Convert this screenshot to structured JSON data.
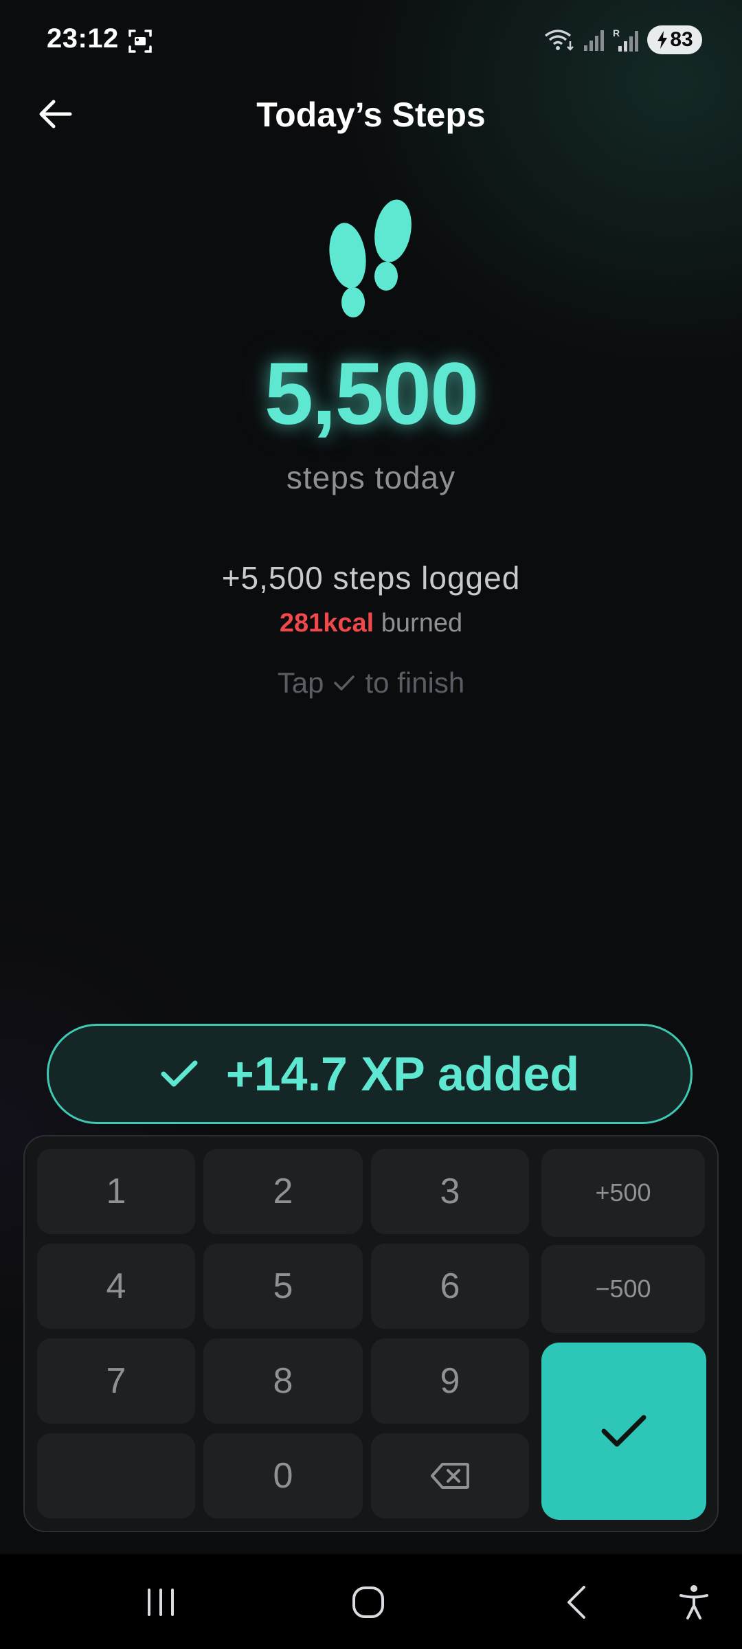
{
  "status_bar": {
    "time": "23:12",
    "battery_level": "83"
  },
  "header": {
    "title": "Today’s Steps"
  },
  "steps": {
    "value": "5,500",
    "caption": "steps today",
    "logged_text": "+5,500 steps logged",
    "kcal": "281kcal",
    "burned_label": " burned",
    "hint_before": "Tap",
    "hint_after": "to finish"
  },
  "toast": {
    "text": "+14.7 XP added"
  },
  "keypad": {
    "keys": [
      "1",
      "2",
      "3",
      "4",
      "5",
      "6",
      "7",
      "8",
      "9",
      "0"
    ],
    "plus_500": "+500",
    "minus_500": "−500"
  },
  "colors": {
    "accent": "#5ee8d1",
    "confirm": "#2ec7b7",
    "kcal": "#f0484b",
    "background": "#0b0c0e"
  },
  "icons": {
    "back": "arrow-left-icon",
    "footprints": "footprints-icon",
    "check": "check-icon",
    "backspace": "backspace-icon",
    "nav_recents": "recents-icon",
    "nav_home": "home-icon",
    "nav_back": "back-chevron-icon",
    "accessibility": "accessibility-icon"
  }
}
